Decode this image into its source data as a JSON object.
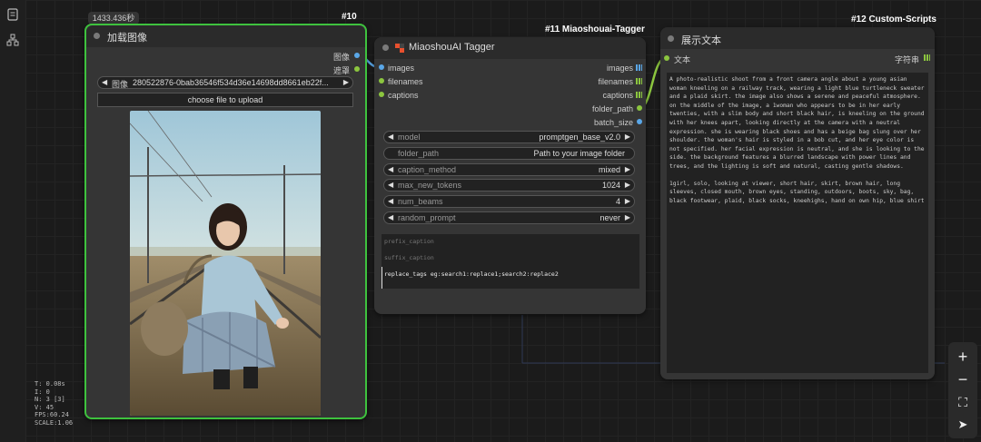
{
  "sidebar": {
    "icons": [
      "panel-icon",
      "workflow-icon"
    ]
  },
  "stats": {
    "lines": [
      "T: 0.08s",
      "I: 0",
      "N: 3 [3]",
      "V: 45",
      "FPS:60.24",
      "SCALE:1.06"
    ]
  },
  "node10": {
    "badge": "1433.436秒",
    "id_label": "#10",
    "title": "加载图像",
    "outputs": [
      "图像",
      "遮罩"
    ],
    "image_arrows": {
      "left": "◀",
      "right": "▶"
    },
    "image_label": "图像",
    "image_value": "280522876-0bab36546f534d36e14698dd8661eb22f...",
    "upload_label": "choose file to upload"
  },
  "node11": {
    "id_label": "#11 Miaoshouai-Tagger",
    "title": "MiaoshouAI Tagger",
    "inputs": [
      "images",
      "filenames",
      "captions"
    ],
    "outputs": [
      "images",
      "filenames",
      "captions",
      "folder_path",
      "batch_size"
    ],
    "widgets": [
      {
        "label": "model",
        "value": "promptgen_base_v2.0",
        "arrows": true
      },
      {
        "label": "folder_path",
        "value": "Path to your image folder",
        "arrows": false
      },
      {
        "label": "caption_method",
        "value": "mixed",
        "arrows": true
      },
      {
        "label": "max_new_tokens",
        "value": "1024",
        "arrows": true
      },
      {
        "label": "num_beams",
        "value": "4",
        "arrows": true
      },
      {
        "label": "random_prompt",
        "value": "never",
        "arrows": true
      }
    ],
    "arrows": {
      "left": "◀",
      "right": "▶"
    },
    "text_placeholders": {
      "prefix": "prefix_caption",
      "suffix": "suffix_caption"
    },
    "replace_tags": "replace_tags eg:search1:replace1;search2:replace2"
  },
  "node12": {
    "id_label": "#12 Custom-Scripts",
    "title": "展示文本",
    "input": "文本",
    "output": "字符串",
    "text_para1": "A photo-realistic shoot from a front camera angle about a young asian woman kneeling on a railway track, wearing a light blue turtleneck sweater and a plaid skirt. the image also shows a serene and peaceful atmosphere. on the middle of the image, a 1woman who appears to be in her early twenties, with a slim body and short black hair, is kneeling on the ground with her knees apart, looking directly at the camera with a neutral expression. she is wearing black shoes and has a beige bag slung over her shoulder. the woman's hair is styled in a bob cut, and her eye color is not specified. her facial expression is neutral, and she is looking to the side. the background features a blurred landscape with power lines and trees, and the lighting is soft and natural, casting gentle shadows.",
    "text_para2": "1girl, solo, looking at viewer, short hair, skirt, brown hair, long sleeves, closed mouth, brown eyes, standing, outdoors, boots, sky, bag, black footwear, plaid, black socks, kneehighs, hand on own hip, blue shirt"
  },
  "controls": {
    "zoom_in": "+",
    "zoom_out": "−",
    "fit": "⛶",
    "locate": "➤"
  },
  "colors": {
    "selected_border": "#3ec23e",
    "image_link": "#5aa7e8",
    "string_link": "#8cc63f"
  }
}
